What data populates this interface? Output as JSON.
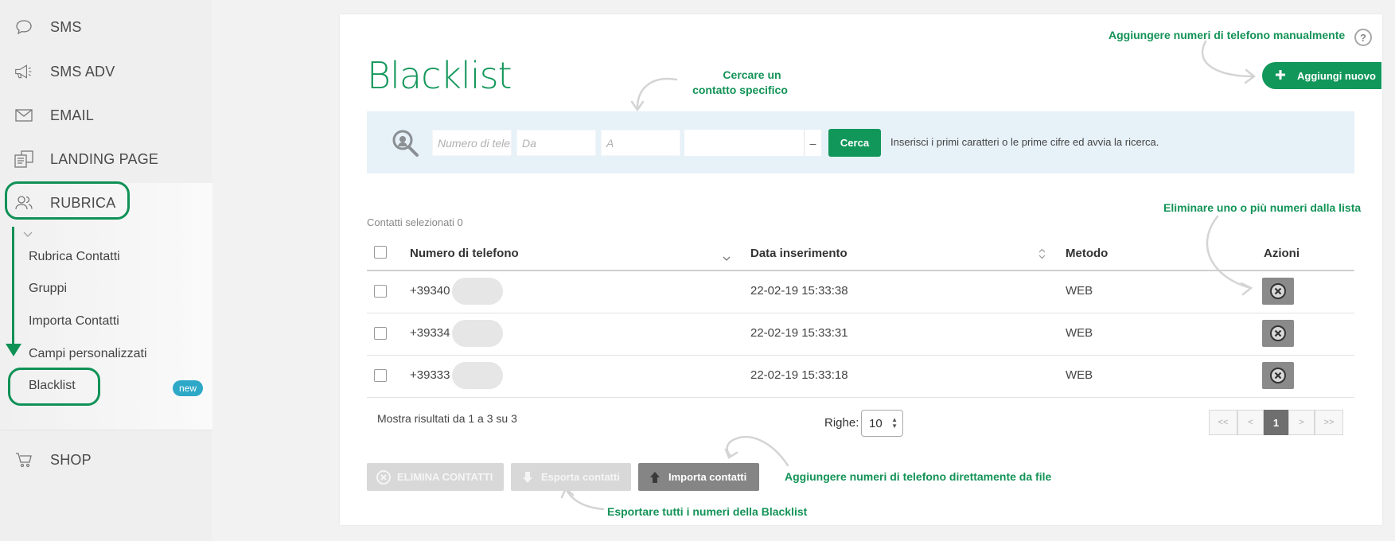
{
  "sidebar": {
    "items": [
      {
        "label": "SMS",
        "icon": "chat-bubble-icon"
      },
      {
        "label": "SMS ADV",
        "icon": "megaphone-icon"
      },
      {
        "label": "EMAIL",
        "icon": "envelope-icon"
      },
      {
        "label": "LANDING PAGE",
        "icon": "pages-icon"
      },
      {
        "label": "RUBRICA",
        "icon": "contacts-icon"
      }
    ],
    "sub_items": [
      "Rubrica Contatti",
      "Gruppi",
      "Importa Contatti",
      "Campi personalizzati",
      "Blacklist"
    ],
    "new_badge": "new",
    "shop": {
      "label": "SHOP",
      "icon": "cart-icon"
    }
  },
  "page": {
    "title": "Blacklist",
    "add_button": "Aggiungi nuovo",
    "help": "?"
  },
  "annotations": {
    "add_manual": "Aggiungere numeri di telefono manualmente",
    "search_1": "Cercare un",
    "search_2": "contatto specifico",
    "delete": "Eliminare uno o più numeri dalla lista",
    "import": "Aggiungere numeri di telefono direttamente da file",
    "export": "Esportare tutti i numeri della Blacklist"
  },
  "search": {
    "phone_placeholder": "Numero di telefono",
    "from_placeholder": "Da",
    "to_placeholder": "A",
    "select_value": "",
    "select_sep": "–",
    "button": "Cerca",
    "hint": "Inserisci i primi caratteri o le prime cifre ed avvia la ricerca."
  },
  "selected_count": "Contatti selezionati 0",
  "table": {
    "headers": [
      "Numero di telefono",
      "Data inserimento",
      "Metodo",
      "Azioni"
    ],
    "rows": [
      {
        "phone": "+39340",
        "date": "22-02-19 15:33:38",
        "method": "WEB"
      },
      {
        "phone": "+39334",
        "date": "22-02-19 15:33:31",
        "method": "WEB"
      },
      {
        "phone": "+39333",
        "date": "22-02-19 15:33:18",
        "method": "WEB"
      }
    ]
  },
  "footer": {
    "results": "Mostra risultati da 1 a 3 su 3",
    "rows_label": "Righe:",
    "rows_value": "10",
    "pager": [
      "<<",
      "<",
      "1",
      ">",
      ">>"
    ]
  },
  "actions": {
    "delete": "ELIMINA CONTATTI",
    "export": "Esporta contatti",
    "import": "Importa contatti"
  },
  "colors": {
    "brand_green": "#11975a",
    "search_bg": "#e7f1f8",
    "badge_blue": "#2ea8c7"
  }
}
